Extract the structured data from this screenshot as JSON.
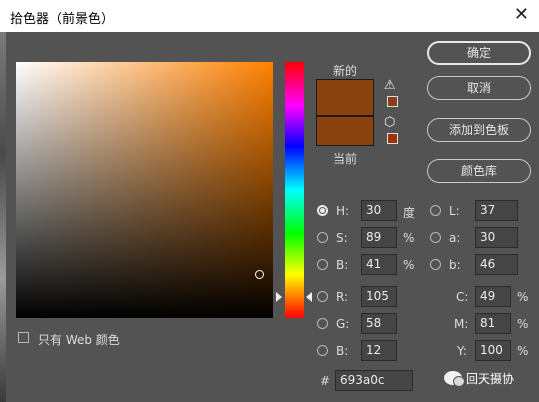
{
  "window": {
    "title": "拾色器（前景色）",
    "close_glyph": "✕"
  },
  "swatch": {
    "new_label": "新的",
    "current_label": "当前",
    "color": "#8a420f"
  },
  "warnings": {
    "gamut_glyph": "⚠",
    "web_glyph": "⬡",
    "gamut_swatch": "#8a3e1e",
    "web_swatch": "#993300"
  },
  "buttons": {
    "ok": "确定",
    "cancel": "取消",
    "add_to_swatches": "添加到色板",
    "color_libraries": "颜色库"
  },
  "hsb": {
    "h": {
      "label": "H:",
      "value": "30",
      "unit": "度",
      "selected": true
    },
    "s": {
      "label": "S:",
      "value": "89",
      "unit": "%"
    },
    "b": {
      "label": "B:",
      "value": "41",
      "unit": "%"
    }
  },
  "rgb": {
    "r": {
      "label": "R:",
      "value": "105"
    },
    "g": {
      "label": "G:",
      "value": "58"
    },
    "b": {
      "label": "B:",
      "value": "12"
    }
  },
  "lab": {
    "l": {
      "label": "L:",
      "value": "37"
    },
    "a": {
      "label": "a:",
      "value": "30"
    },
    "b": {
      "label": "b:",
      "value": "46"
    }
  },
  "cmyk": {
    "c": {
      "label": "C:",
      "value": "49",
      "unit": "%"
    },
    "m": {
      "label": "M:",
      "value": "81",
      "unit": "%"
    },
    "y": {
      "label": "Y:",
      "value": "100",
      "unit": "%"
    }
  },
  "hex": {
    "label": "#",
    "value": "693a0c"
  },
  "web_only": {
    "label": "只有 Web 颜色",
    "checked": false
  },
  "watermark": {
    "text": "回天摄协"
  }
}
